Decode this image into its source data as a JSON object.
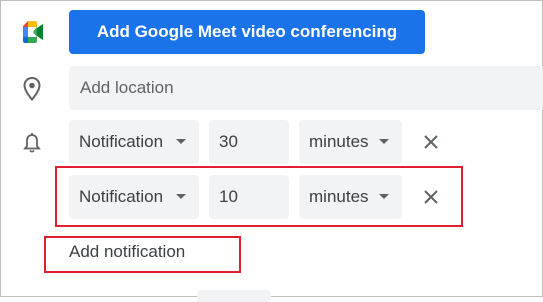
{
  "meet": {
    "button_label": "Add Google Meet video conferencing",
    "logo_icon": "google-meet-icon"
  },
  "location": {
    "icon": "location-pin-icon",
    "placeholder": "Add location"
  },
  "notifications": {
    "icon": "bell-icon",
    "items": [
      {
        "type": "Notification",
        "value": "30",
        "unit": "minutes",
        "remove_icon": "close-icon"
      },
      {
        "type": "Notification",
        "value": "10",
        "unit": "minutes",
        "remove_icon": "close-icon"
      }
    ],
    "add_label": "Add notification"
  },
  "colors": {
    "accent": "#1a73e8",
    "field_bg": "#f1f3f4",
    "highlight": "#e0202e"
  }
}
